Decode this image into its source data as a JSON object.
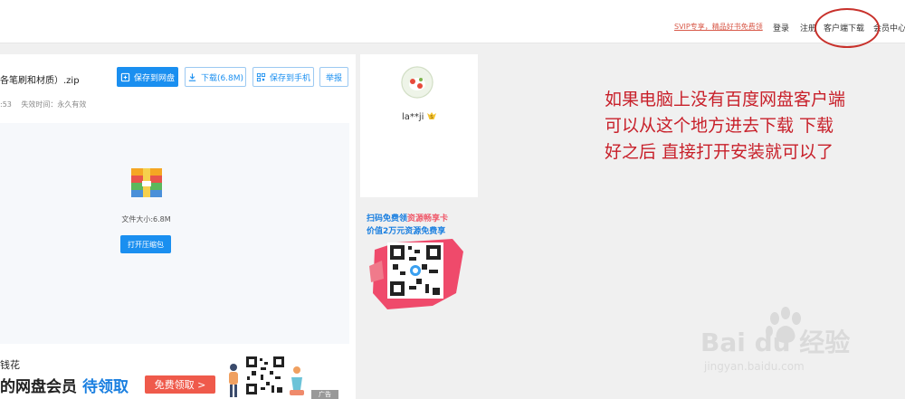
{
  "topbar": {
    "promo": "SVIP专享，精品好书免费领",
    "login": "登录",
    "register": "注册",
    "client_download": "客户端下载",
    "member_center": "会员中心"
  },
  "file": {
    "name": "各笔刷和材质）.zip",
    "time_partial": ":53",
    "expire": "失效时间：永久有效",
    "buttons": {
      "save_to_disk": "保存到网盘",
      "download": "下载(6.8M)",
      "save_to_phone": "保存到手机",
      "report": "举报"
    },
    "size": "文件大小:6.8M",
    "open_zip": "打开压缩包"
  },
  "ad": {
    "line1": "钱花",
    "line2_a": "的网盘会员",
    "line2_b": "待领取",
    "claim": "免费领取 >",
    "tag": "广告"
  },
  "user": {
    "name": "la**ji",
    "badge": "S"
  },
  "qr_promo": {
    "line1_a": "扫码免费领",
    "line1_b": "资源畅享卡",
    "line2": "价值2万元资源免费享"
  },
  "annotation": {
    "lines": [
      "如果电脑上没有百度网盘客户端",
      "可以从这个地方进去下载  下载",
      "好之后  直接打开安装就可以了"
    ]
  },
  "watermark": {
    "brand": "Bai du 经验",
    "url": "jingyan.baidu.com"
  },
  "colors": {
    "primary_blue": "#1a8ff0",
    "annotation_red": "#c8202a",
    "promo_red": "#d85a4a"
  }
}
